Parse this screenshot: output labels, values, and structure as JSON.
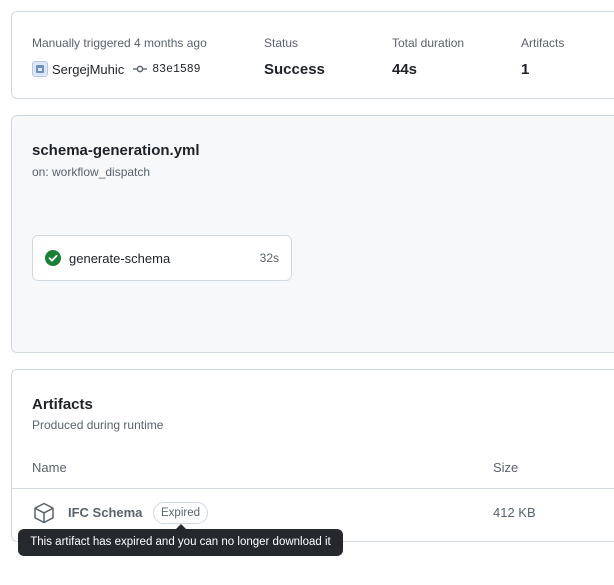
{
  "summary": {
    "trigger_label": "Manually triggered 4 months ago",
    "actor": "SergejMuhic",
    "commit": "83e1589",
    "status_label": "Status",
    "status_value": "Success",
    "duration_label": "Total duration",
    "duration_value": "44s",
    "artifacts_label": "Artifacts",
    "artifacts_value": "1"
  },
  "workflow": {
    "file": "schema-generation.yml",
    "trigger": "on: workflow_dispatch",
    "jobs": [
      {
        "name": "generate-schema",
        "duration": "32s",
        "status": "success"
      }
    ]
  },
  "artifacts": {
    "title": "Artifacts",
    "subtitle": "Produced during runtime",
    "columns": {
      "name": "Name",
      "size": "Size"
    },
    "rows": [
      {
        "name": "IFC Schema",
        "badge": "Expired",
        "size": "412 KB",
        "icon": "package-icon"
      }
    ]
  },
  "tooltip": "This artifact has expired and you can no longer download it",
  "colors": {
    "success": "#1a7f37",
    "tooltip_bg": "#25292e",
    "border": "#d1d9e0",
    "muted": "#59636e"
  }
}
